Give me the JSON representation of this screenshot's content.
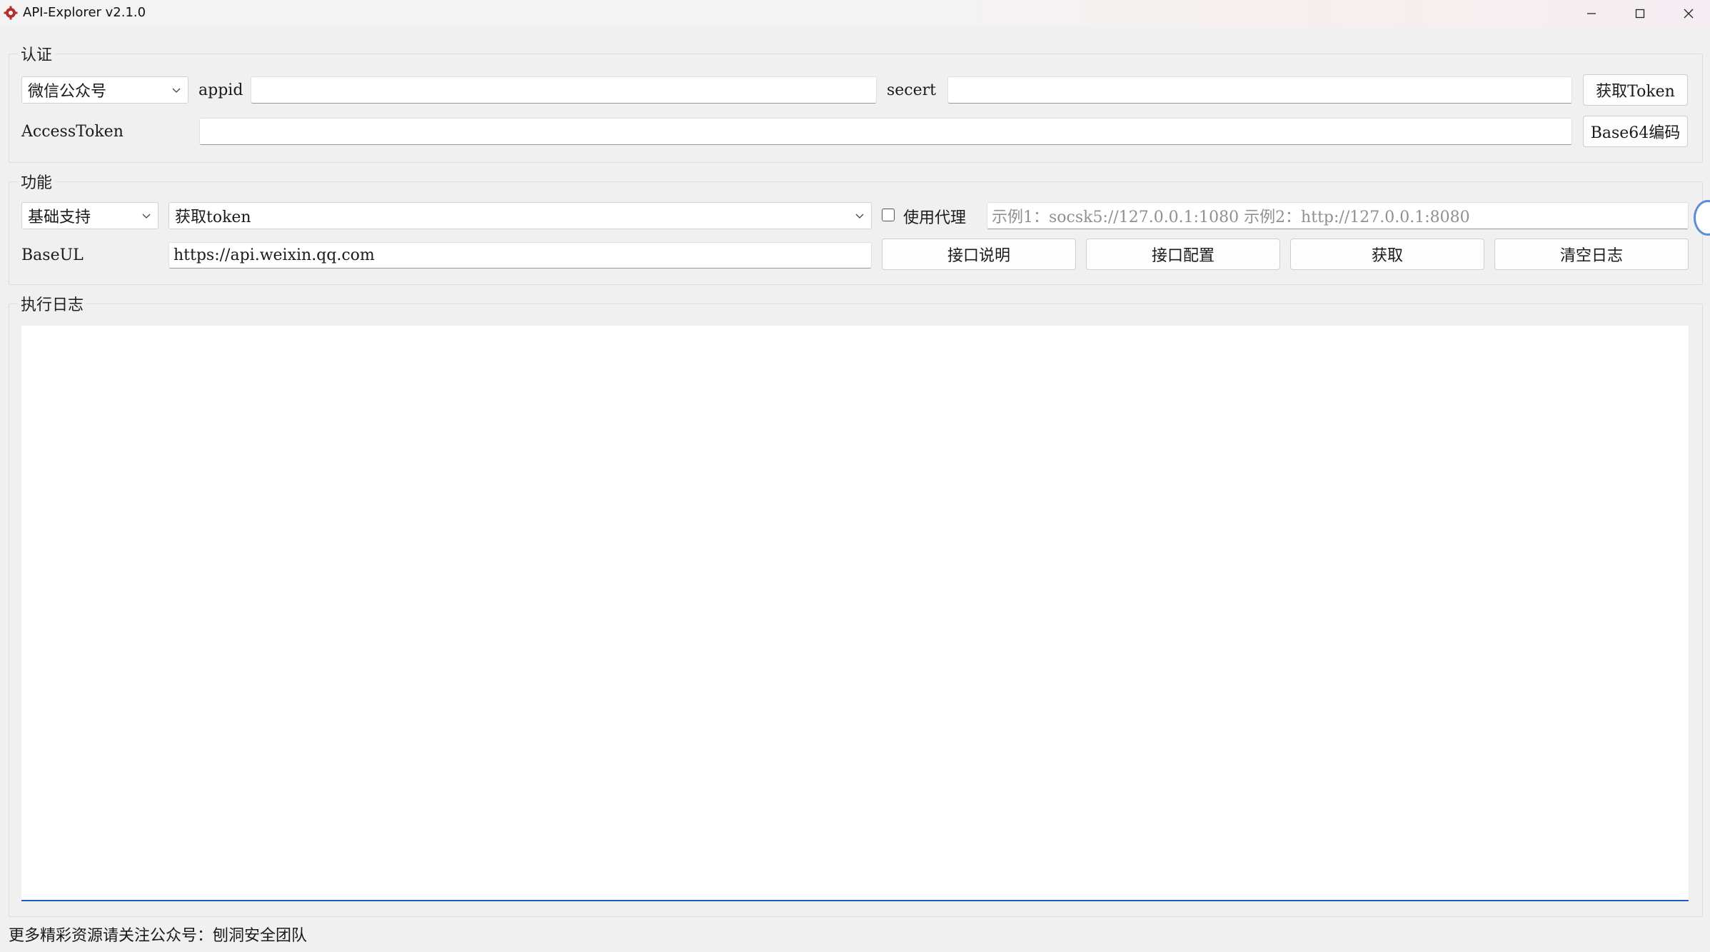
{
  "window": {
    "title": "API-Explorer v2.1.0",
    "icon": "gear-app-icon"
  },
  "auth": {
    "legend": "认证",
    "platform_select": "微信公众号",
    "appid_label": "appid",
    "appid_value": "",
    "secret_label": "secert",
    "secret_value": "",
    "get_token_button": "获取Token",
    "access_token_label": "AccessToken",
    "access_token_value": "",
    "base64_button": "Base64编码"
  },
  "function": {
    "legend": "功能",
    "category_select": "基础支持",
    "api_select": "获取token",
    "proxy_checkbox_label": "使用代理",
    "proxy_checked": false,
    "proxy_placeholder": "示例1：socsk5://127.0.0.1:1080 示例2：http://127.0.0.1:8080",
    "baseurl_label": "BaseUL",
    "baseurl_value": "https://api.weixin.qq.com",
    "buttons": [
      "接口说明",
      "接口配置",
      "获取",
      "清空日志"
    ]
  },
  "log": {
    "legend": "执行日志",
    "content": ""
  },
  "status_bar": {
    "text": "更多精彩资源请关注公众号：刨洞安全团队"
  }
}
